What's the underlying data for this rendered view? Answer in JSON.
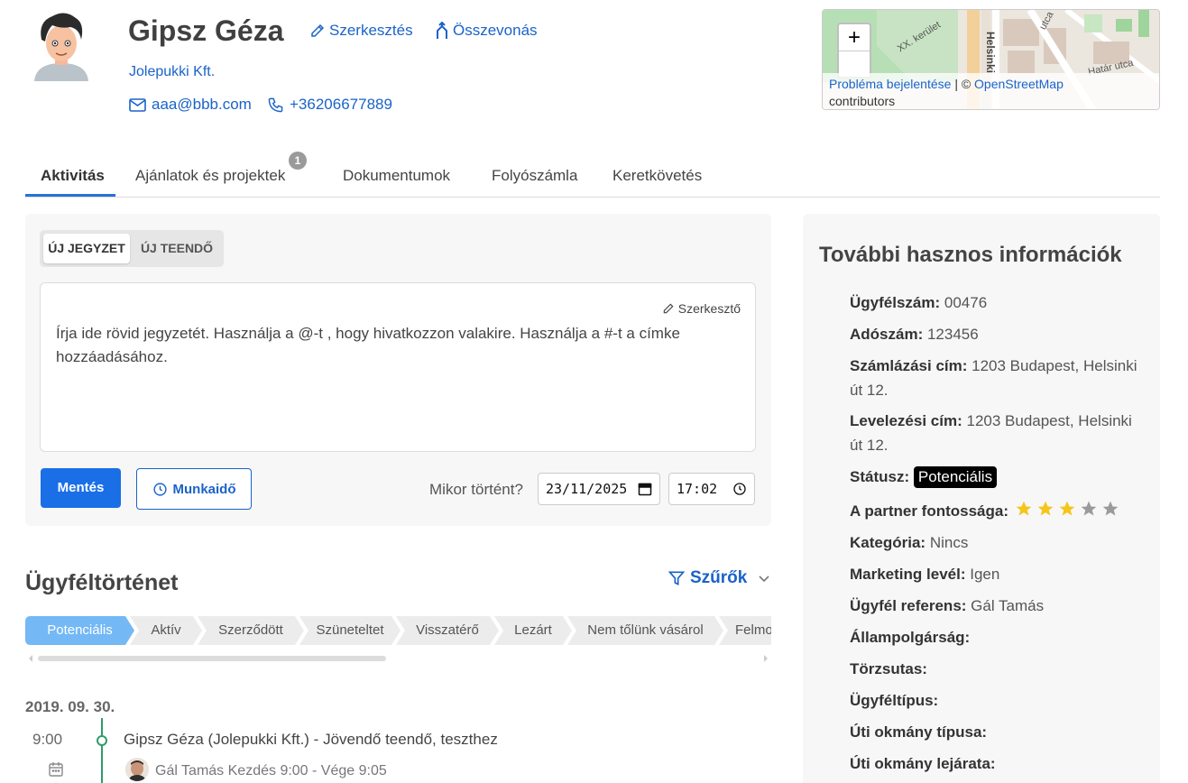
{
  "header": {
    "name": "Gipsz Géza",
    "edit_label": "Szerkesztés",
    "merge_label": "Összevonás",
    "company": "Jolepukki Kft.",
    "email": "aaa@bbb.com",
    "phone": "+36206677889"
  },
  "map": {
    "zoom_in": "+",
    "attribution_report": "Probléma bejelentése",
    "attribution_sep": "| ©",
    "attribution_osm": "OpenStreetMap",
    "attribution_contrib": "contributors",
    "street_labels": [
      "XX. kerület",
      "Helsinki",
      "utca",
      "Határ utca"
    ]
  },
  "tabs": [
    {
      "label": "Aktivitás",
      "active": true
    },
    {
      "label": "Ajánlatok és projektek",
      "badge": "1"
    },
    {
      "label": "Dokumentumok"
    },
    {
      "label": "Folyószámla"
    },
    {
      "label": "Keretkövetés"
    }
  ],
  "note": {
    "tab_note": "ÚJ JEGYZET",
    "tab_todo": "ÚJ TEENDŐ",
    "editor_tool": "Szerkesztő",
    "placeholder": "Írja ide rövid jegyzetét. Használja a @-t , hogy hivatkozzon valakire. Használja a #-t a címke hozzáadásához.",
    "save": "Mentés",
    "worktime": "Munkaidő",
    "when_label": "Mikor történt?",
    "date_value": "23/11/2025",
    "time_value": "17:02"
  },
  "history": {
    "title": "Ügyféltörténet",
    "filters": "Szűrők",
    "stages": [
      "Potenciális",
      "Aktív",
      "Szerződött",
      "Szüneteltet",
      "Visszatérő",
      "Lezárt",
      "Nem tőlünk vásárol",
      "Felmo"
    ],
    "date": "2019. 09. 30.",
    "entry_time": "9:00",
    "entry_text": "Gipsz Géza (Jolepukki Kft.) - Jövendő teendő, teszthez",
    "entry_sub": "Gál Tamás Kezdés 9:00 - Vége 9:05"
  },
  "info": {
    "title": "További hasznos információk",
    "rows": [
      {
        "label": "Ügyfélszám:",
        "value": "00476"
      },
      {
        "label": "Adószám:",
        "value": "123456"
      },
      {
        "label": "Számlázási cím:",
        "value": "1203 Budapest, Helsinki út 12."
      },
      {
        "label": "Levelezési cím:",
        "value": "1203 Budapest, Helsinki út 12."
      },
      {
        "label": "Státusz:",
        "value": "Potenciális"
      },
      {
        "label": "A partner fontossága:",
        "rating": 3,
        "max": 5
      },
      {
        "label": "Kategória:",
        "value": "Nincs"
      },
      {
        "label": "Marketing levél:",
        "value": "Igen"
      },
      {
        "label": "Ügyfél referens:",
        "value": "Gál Tamás"
      },
      {
        "label": "Állampolgárság:",
        "value": ""
      },
      {
        "label": "Törzsutas:",
        "value": ""
      },
      {
        "label": "Ügyféltípus:",
        "value": ""
      },
      {
        "label": "Úti okmány típusa:",
        "value": ""
      },
      {
        "label": "Úti okmány lejárata:",
        "value": ""
      }
    ]
  },
  "colors": {
    "accent": "#1a63c9",
    "primary_button": "#1a6fe6",
    "active_stage": "#74b8f5",
    "timeline": "#2e9c6b",
    "star_on": "#f5c518",
    "star_off": "#9a9a9a"
  }
}
